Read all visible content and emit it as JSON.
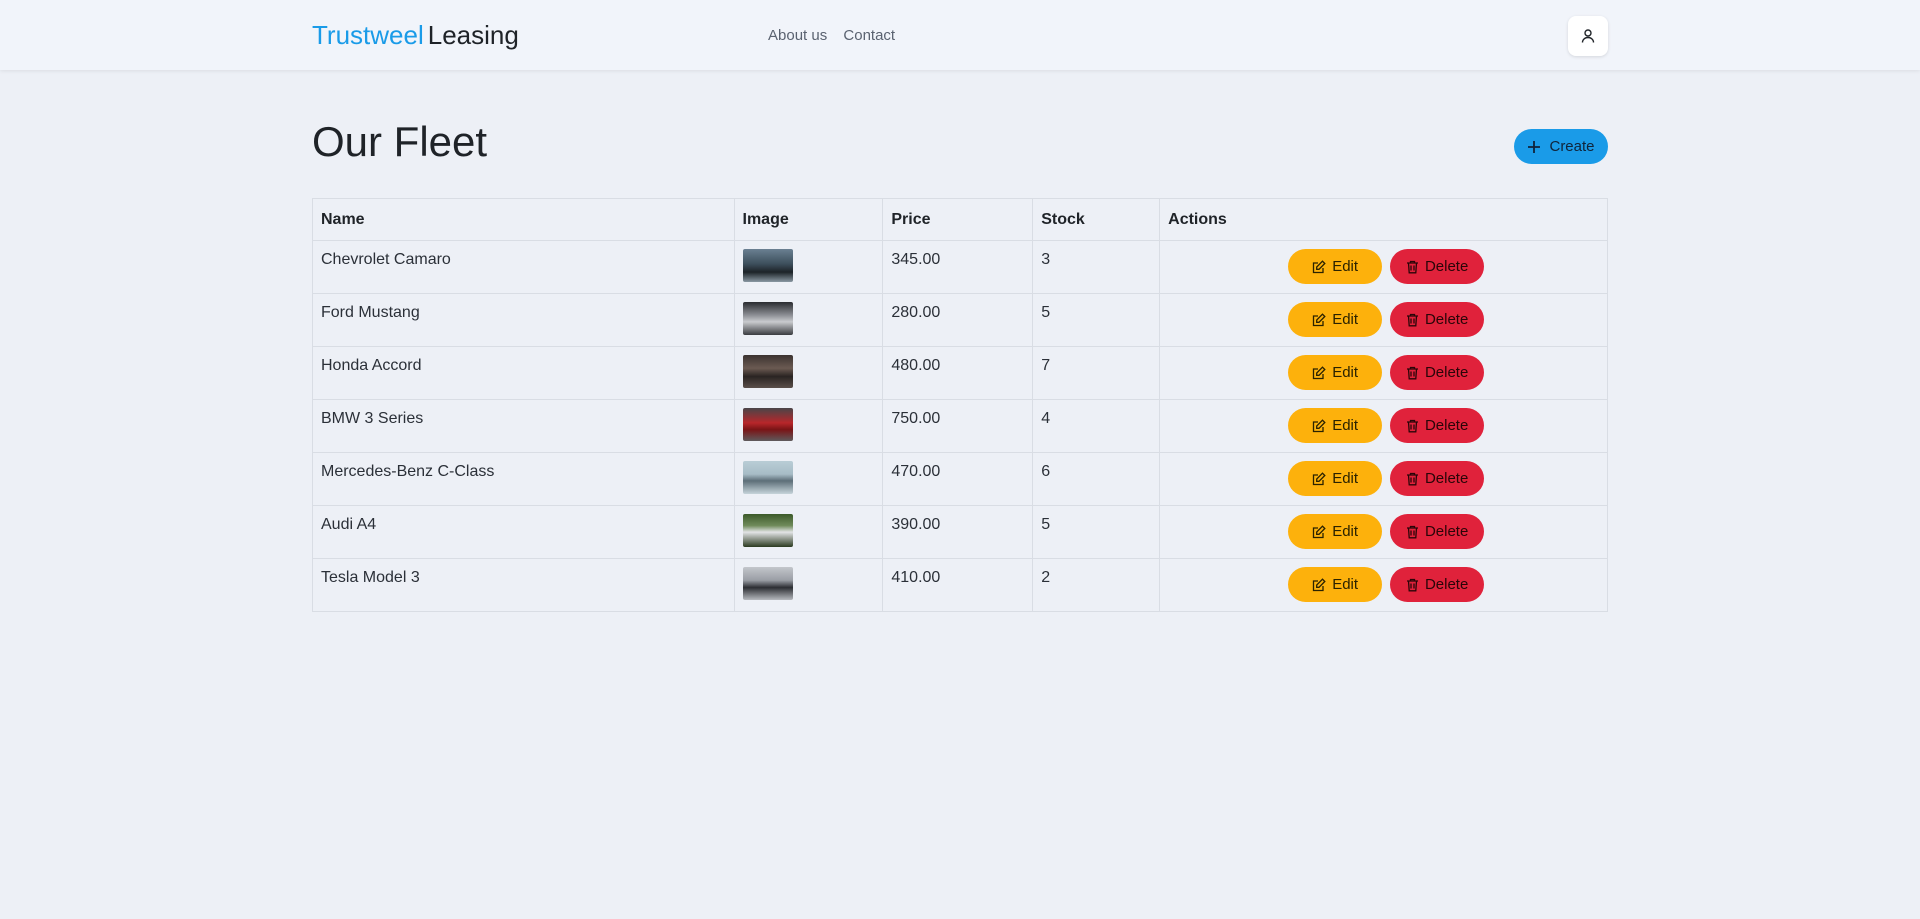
{
  "brand": {
    "part1": "Trustweel",
    "part2": "Leasing"
  },
  "nav": {
    "links": [
      "About us",
      "Contact"
    ]
  },
  "page": {
    "title": "Our Fleet",
    "create_label": "Create"
  },
  "table": {
    "headers": [
      "Name",
      "Image",
      "Price",
      "Stock",
      "Actions"
    ],
    "edit_label": "Edit",
    "delete_label": "Delete",
    "rows": [
      {
        "name": "Chevrolet Camaro",
        "price": "345.00",
        "stock": "3"
      },
      {
        "name": "Ford Mustang",
        "price": "280.00",
        "stock": "5"
      },
      {
        "name": "Honda Accord",
        "price": "480.00",
        "stock": "7"
      },
      {
        "name": "BMW 3 Series",
        "price": "750.00",
        "stock": "4"
      },
      {
        "name": "Mercedes-Benz C-Class",
        "price": "470.00",
        "stock": "6"
      },
      {
        "name": "Audi A4",
        "price": "390.00",
        "stock": "5"
      },
      {
        "name": "Tesla Model 3",
        "price": "410.00",
        "stock": "2"
      }
    ]
  },
  "icons": {
    "user": "user-icon",
    "create": "plus-icon",
    "edit": "pencil-square-icon",
    "delete": "trash-icon"
  },
  "colors": {
    "accent": "#1a9be8",
    "edit": "#fdb10c",
    "delete": "#e0223b",
    "background": "#edf0f6"
  }
}
